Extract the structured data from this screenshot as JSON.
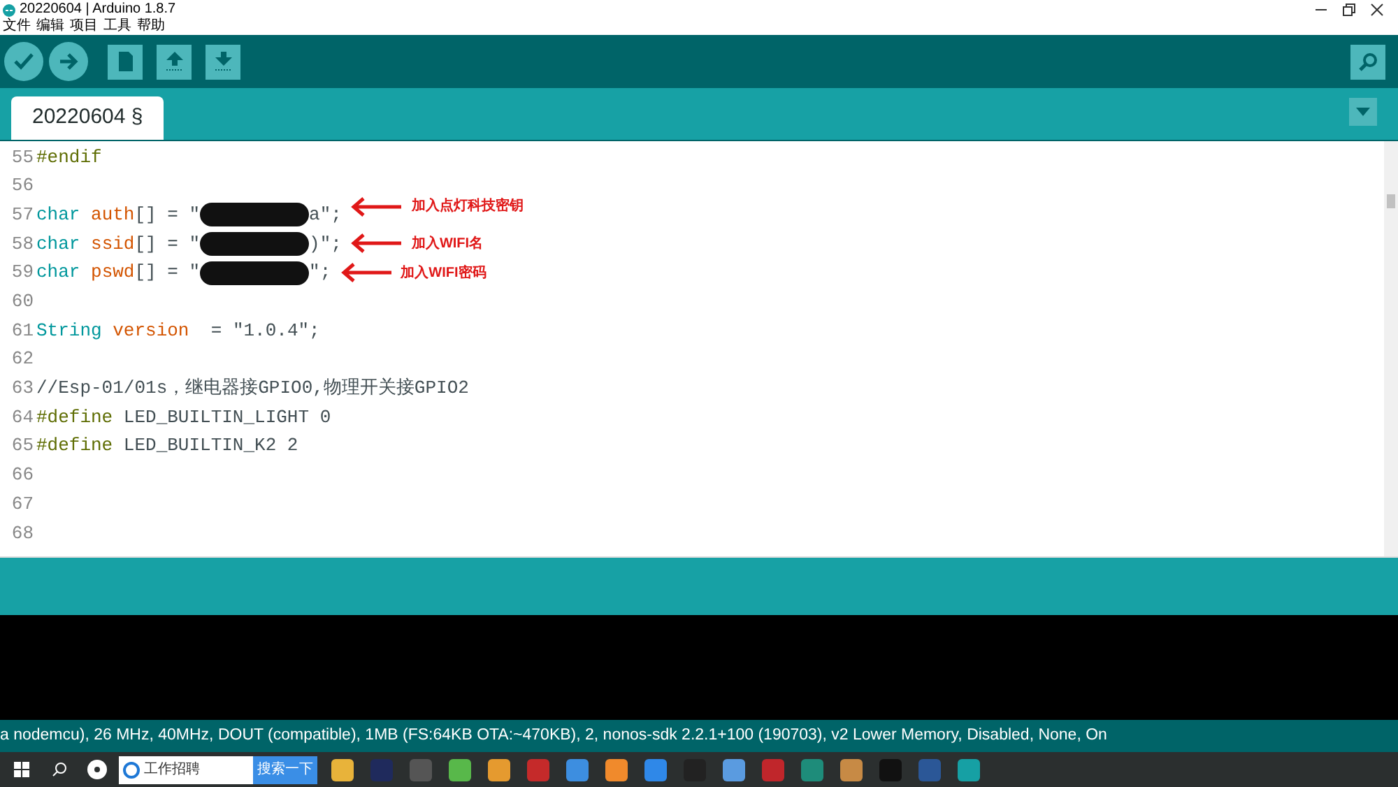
{
  "window": {
    "title": "20220604 | Arduino 1.8.7"
  },
  "menu": [
    "文件",
    "编辑",
    "项目",
    "工具",
    "帮助"
  ],
  "toolbar": [
    {
      "kind": "round"
    },
    {
      "kind": "round"
    },
    {
      "kind": "square"
    },
    {
      "kind": "square"
    },
    {
      "kind": "square"
    }
  ],
  "tabs": [
    {
      "label": "20220604 §",
      "selected": true
    }
  ],
  "code": [
    {
      "n": "55",
      "tokens": [
        {
          "kind": "directive",
          "text": "#endif"
        }
      ]
    },
    {
      "n": "56"
    },
    {
      "n": "57",
      "tokens": [
        {
          "kind": "type",
          "text": "char"
        },
        {
          "kind": "ident",
          "text": " auth"
        },
        {
          "kind": "plain",
          "text": "[] = \""
        },
        {
          "kind": "redaction"
        },
        {
          "kind": "plain",
          "text": "a\";"
        }
      ],
      "annotation": "加入点灯科技密钥"
    },
    {
      "n": "58",
      "tokens": [
        {
          "kind": "type",
          "text": "char"
        },
        {
          "kind": "ident",
          "text": " ssid"
        },
        {
          "kind": "plain",
          "text": "[] = \""
        },
        {
          "kind": "redaction"
        },
        {
          "kind": "plain",
          "text": ")\";"
        }
      ],
      "annotation": "加入WIFI名"
    },
    {
      "n": "59",
      "tokens": [
        {
          "kind": "type",
          "text": "char"
        },
        {
          "kind": "ident",
          "text": " pswd"
        },
        {
          "kind": "plain",
          "text": "[] = \""
        },
        {
          "kind": "redaction"
        },
        {
          "kind": "plain",
          "text": "\";"
        }
      ],
      "annotation": "加入WIFI密码"
    },
    {
      "n": "60"
    },
    {
      "n": "61",
      "tokens": [
        {
          "kind": "type",
          "text": "String"
        },
        {
          "kind": "ident",
          "text": " version"
        },
        {
          "kind": "plain",
          "text": "  = \"1.0.4\";"
        }
      ]
    },
    {
      "n": "62"
    },
    {
      "n": "63",
      "tokens": [
        {
          "kind": "plain",
          "text": "//Esp-01/01s，继电器接GPIO0,物理开关接GPIO2"
        }
      ]
    },
    {
      "n": "64",
      "tokens": [
        {
          "kind": "directive",
          "text": "#define"
        },
        {
          "kind": "plain",
          "text": " LED_BUILTIN_LIGHT 0"
        }
      ]
    },
    {
      "n": "65",
      "tokens": [
        {
          "kind": "directive",
          "text": "#define"
        },
        {
          "kind": "plain",
          "text": " LED_BUILTIN_K2 2"
        }
      ]
    },
    {
      "n": "66"
    },
    {
      "n": "67"
    },
    {
      "n": "68"
    }
  ],
  "status_bar": "a nodemcu), 26 MHz, 40MHz, DOUT (compatible), 1MB (FS:64KB OTA:~470KB), 2, nonos-sdk 2.2.1+100 (190703), v2 Lower Memory, Disabled, None, On",
  "taskbar": {
    "search_value": "工作招聘",
    "search_button": "搜索一下",
    "apps": [
      {
        "color": "#e8b33a"
      },
      {
        "color": "#1f2a5c"
      },
      {
        "color": "#555555"
      },
      {
        "color": "#58b84a"
      },
      {
        "color": "#e59a2f"
      },
      {
        "color": "#c52a2a"
      },
      {
        "color": "#3d8ee0"
      },
      {
        "color": "#f08a2c"
      },
      {
        "color": "#2f88e8"
      },
      {
        "color": "#222222"
      },
      {
        "color": "#5a9be0"
      },
      {
        "color": "#c0262b"
      },
      {
        "color": "#1e8c7a"
      },
      {
        "color": "#c78a45"
      },
      {
        "color": "#111111"
      },
      {
        "color": "#2b5797"
      },
      {
        "color": "#16a0a4"
      }
    ]
  }
}
